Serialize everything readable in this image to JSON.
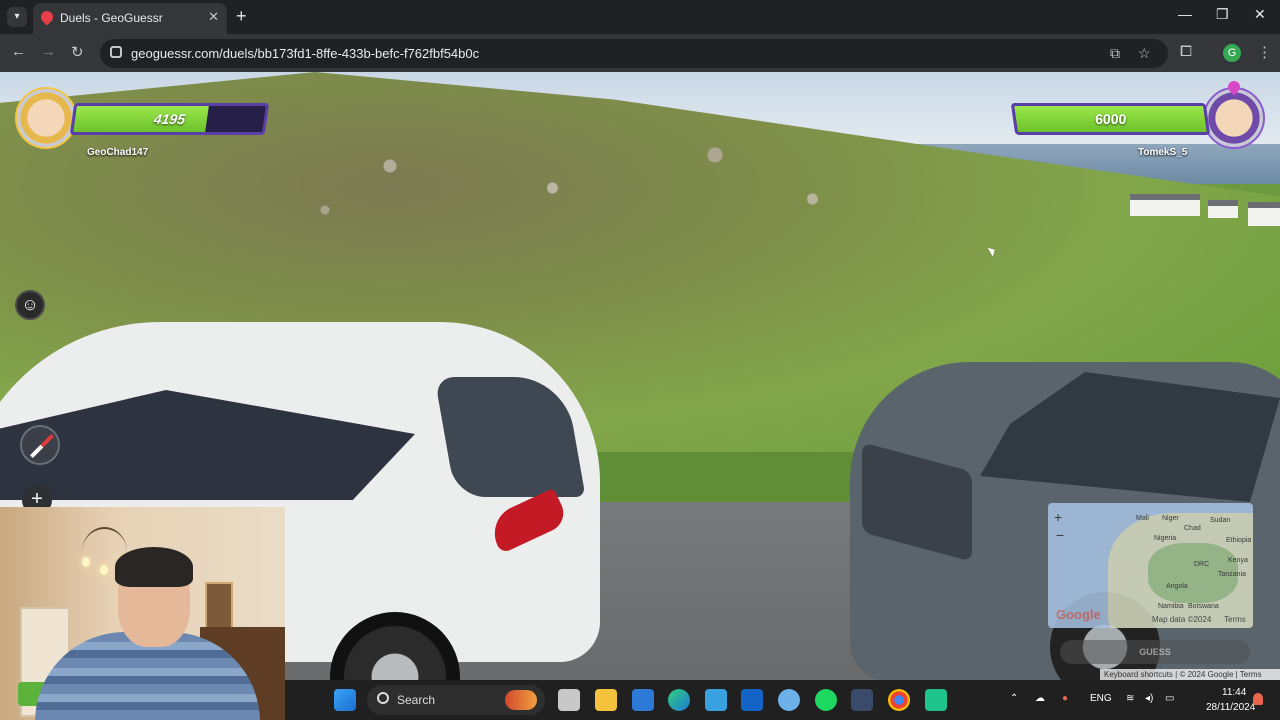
{
  "browser": {
    "tab_title": "Duels - GeoGuessr",
    "url": "geoguessr.com/duels/bb173fd1-8ffe-433b-befc-f762fbf54b0c",
    "profile_initial": "G"
  },
  "duel": {
    "left_player": {
      "name": "GeoChad147",
      "health": "4195",
      "health_fraction": 0.6992
    },
    "right_player": {
      "name": "TomekS_5",
      "health": "6000",
      "health_fraction": 1.0
    }
  },
  "minimap": {
    "labels": [
      "Mali",
      "Niger",
      "Chad",
      "Sudan",
      "Nigeria",
      "Ethiopia",
      "Kenya",
      "DRC",
      "Tanzania",
      "Angola",
      "Namibia",
      "Botswana"
    ],
    "google": "Google",
    "map_data": "Map data ©2024",
    "terms": "Terms",
    "guess_label": "GUESS"
  },
  "attribution": {
    "keyboard": "Keyboard shortcuts",
    "copyright": "© 2024 Google",
    "terms": "Terms"
  },
  "taskbar": {
    "search_placeholder": "Search",
    "language": "ENG",
    "time": "11:44",
    "date": "28/11/2024"
  },
  "colors": {
    "health_green": "#8bd83e",
    "health_frame": "#5b3fa8",
    "chrome_dark": "#202124"
  }
}
